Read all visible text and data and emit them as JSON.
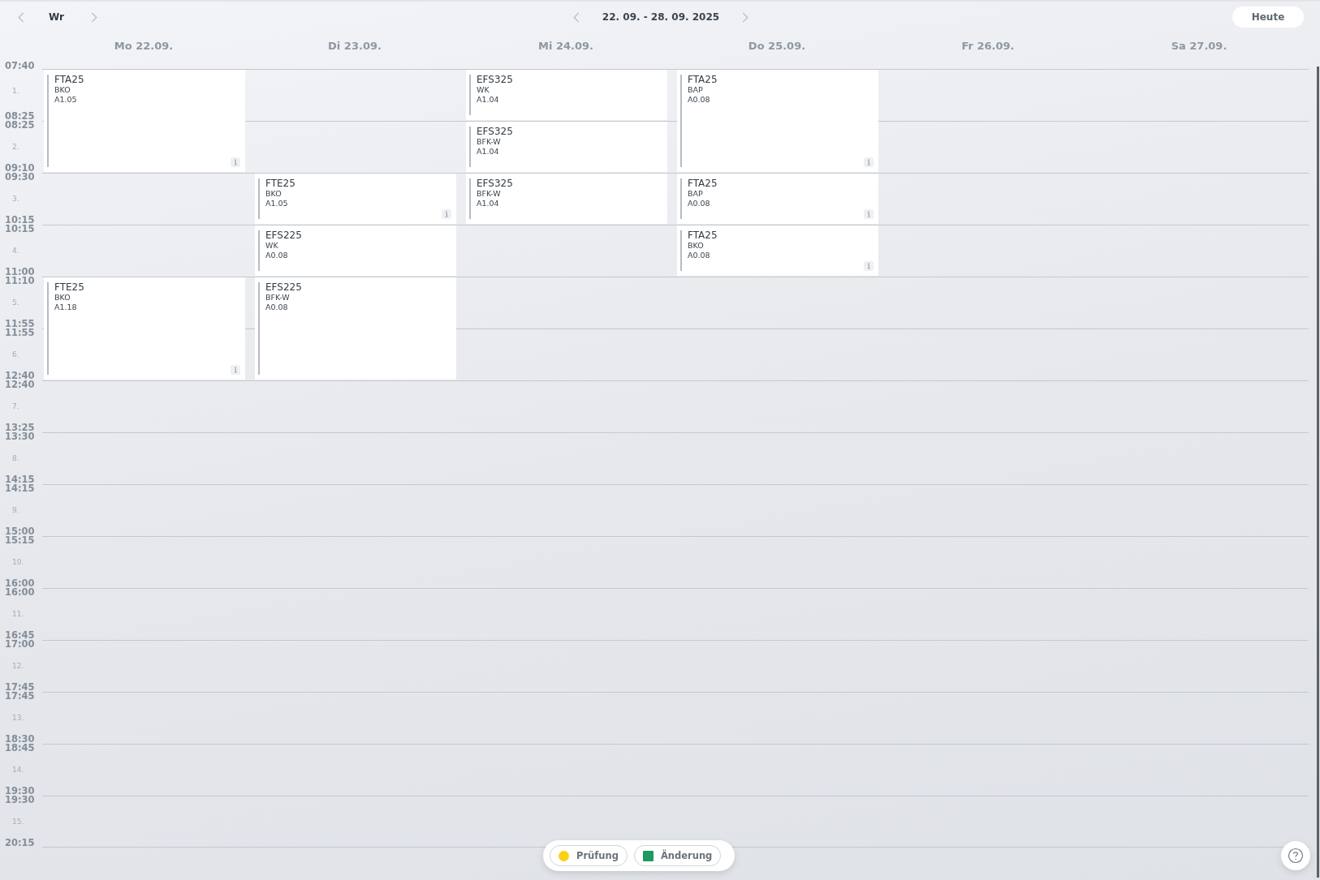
{
  "top_bar": {
    "view_label": "Wr",
    "week_range": "22. 09. - 28. 09. 2025",
    "today_button": "Heute"
  },
  "periods": [
    {
      "start": "07:40",
      "number": "1.",
      "end": "08:25"
    },
    {
      "start": "08:25",
      "number": "2.",
      "end": "09:10"
    },
    {
      "start": "09:30",
      "number": "3.",
      "end": "10:15"
    },
    {
      "start": "10:15",
      "number": "4.",
      "end": "11:00"
    },
    {
      "start": "11:10",
      "number": "5.",
      "end": "11:55"
    },
    {
      "start": "11:55",
      "number": "6.",
      "end": "12:40"
    },
    {
      "start": "12:40",
      "number": "7.",
      "end": "13:25"
    },
    {
      "start": "13:30",
      "number": "8.",
      "end": "14:15"
    },
    {
      "start": "14:15",
      "number": "9.",
      "end": "15:00"
    },
    {
      "start": "15:15",
      "number": "10.",
      "end": "16:00"
    },
    {
      "start": "16:00",
      "number": "11.",
      "end": "16:45"
    },
    {
      "start": "17:00",
      "number": "12.",
      "end": "17:45"
    },
    {
      "start": "17:45",
      "number": "13.",
      "end": "18:30"
    },
    {
      "start": "18:45",
      "number": "14.",
      "end": "19:30"
    },
    {
      "start": "19:30",
      "number": "15.",
      "end": "20:15"
    }
  ],
  "days": [
    {
      "label": "Mo 22.09.",
      "slots": [
        {
          "kind": "lesson",
          "class": "FTA25",
          "subject": "BKO",
          "room": "A1.05",
          "info": true
        },
        {
          "kind": "continued"
        },
        {
          "kind": "free"
        },
        {
          "kind": "free"
        },
        {
          "kind": "lesson",
          "class": "FTE25",
          "subject": "BKO",
          "room": "A1.18",
          "info": true
        },
        {
          "kind": "continued"
        }
      ]
    },
    {
      "label": "Di 23.09.",
      "slots": [
        {
          "kind": "free"
        },
        {
          "kind": "free"
        },
        {
          "kind": "lesson",
          "class": "FTE25",
          "subject": "BKO",
          "room": "A1.05",
          "info": true
        },
        {
          "kind": "lesson",
          "class": "EFS225",
          "subject": "WK",
          "room": "A0.08",
          "info": false
        },
        {
          "kind": "lesson",
          "class": "EFS225",
          "subject": "BFK-W",
          "room": "A0.08",
          "info": false
        },
        {
          "kind": "continued"
        }
      ]
    },
    {
      "label": "Mi 24.09.",
      "slots": [
        {
          "kind": "lesson",
          "class": "EFS325",
          "subject": "WK",
          "room": "A1.04",
          "info": false
        },
        {
          "kind": "lesson",
          "class": "EFS325",
          "subject": "BFK-W",
          "room": "A1.04",
          "info": false
        },
        {
          "kind": "lesson",
          "class": "EFS325",
          "subject": "BFK-W",
          "room": "A1.04",
          "info": false
        }
      ]
    },
    {
      "label": "Do 25.09.",
      "slots": [
        {
          "kind": "lesson",
          "class": "FTA25",
          "subject": "BAP",
          "room": "A0.08",
          "info": true
        },
        {
          "kind": "continued"
        },
        {
          "kind": "lesson",
          "class": "FTA25",
          "subject": "BAP",
          "room": "A0.08",
          "info": true
        },
        {
          "kind": "lesson",
          "class": "FTA25",
          "subject": "BKO",
          "room": "A0.08",
          "info": true
        }
      ]
    },
    {
      "label": "Fr 26.09."
    },
    {
      "label": "Sa 27.09."
    }
  ],
  "legend": [
    {
      "label": "Prüfung",
      "kind": "circle",
      "color": "#fbd116"
    },
    {
      "label": "Änderung",
      "kind": "square",
      "color": "#1e9a5e"
    }
  ]
}
